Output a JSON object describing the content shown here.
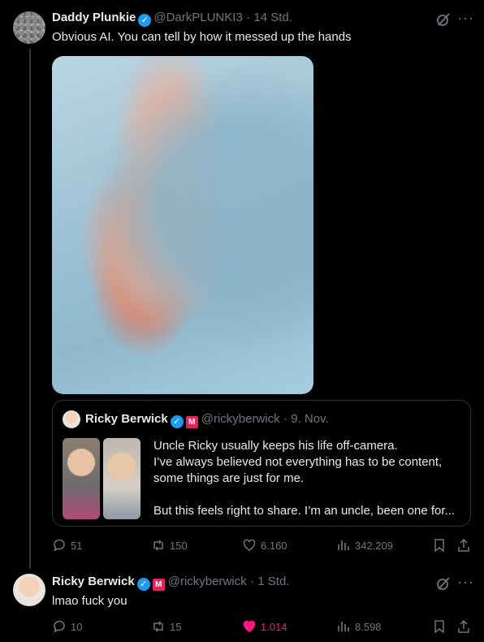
{
  "tweet1": {
    "author": "Daddy Plunkie",
    "handle": "@DarkPLUNKI3",
    "time": "· 14 Std.",
    "text": "Obvious AI. You can tell by how it messed up the hands",
    "quote": {
      "author": "Ricky Berwick",
      "badge": "M",
      "handle": "@rickyberwick",
      "time": "· 9. Nov.",
      "lines": [
        "Uncle Ricky usually keeps his life off-camera.",
        "I’ve always believed not everything has to be content,",
        "some things are just for me.",
        "But this feels right to share. I’m an uncle, been one for..."
      ]
    },
    "stats": {
      "replies": "51",
      "reposts": "150",
      "likes": "6.160",
      "views": "342.209"
    }
  },
  "tweet2": {
    "author": "Ricky Berwick",
    "badge": "M",
    "handle": "@rickyberwick",
    "time": "· 1 Std.",
    "text": "lmao fuck you",
    "stats": {
      "replies": "10",
      "reposts": "15",
      "likes": "1.014",
      "views": "8.598"
    }
  },
  "colors": {
    "background": "#000000",
    "verified": "#1d9bf0",
    "like": "#f91880",
    "muted": "#71767b"
  },
  "icons": [
    "grok-icon",
    "more-icon",
    "reply-icon",
    "repost-icon",
    "like-icon",
    "views-icon",
    "bookmark-icon",
    "share-icon",
    "verified-icon"
  ]
}
